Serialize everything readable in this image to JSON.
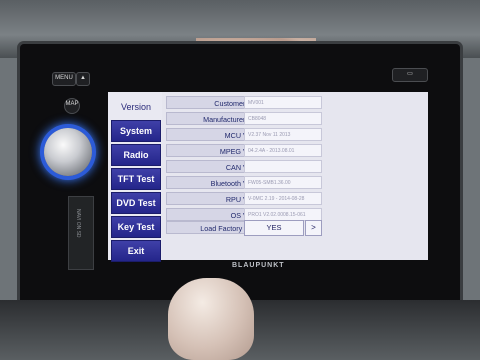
{
  "device": {
    "brand": "BLAUPUNKT",
    "hw_buttons": [
      "MENU",
      "MAP"
    ],
    "slot_label": "NAVI ON SD"
  },
  "menu": {
    "items": [
      {
        "label": "Version",
        "active": true
      },
      {
        "label": "System"
      },
      {
        "label": "Radio"
      },
      {
        "label": "TFT Test"
      },
      {
        "label": "DVD Test"
      },
      {
        "label": "Key Test"
      },
      {
        "label": "Exit"
      }
    ]
  },
  "rows": [
    {
      "label": "Customer Model",
      "value": "MV001"
    },
    {
      "label": "Manufacturer Model",
      "value": "CB8048"
    },
    {
      "label": "MCU Version",
      "value": "V2.37 Nov 11 2013"
    },
    {
      "label": "MPEG Version",
      "value": "04.2.4A - 2013.08.01"
    },
    {
      "label": "CAN Version",
      "value": ""
    },
    {
      "label": "Bluetooth Version",
      "value": "FW05-SMB1.36.00"
    },
    {
      "label": "RPU Version",
      "value": "V-0MC 2.19 - 2014-08-28"
    },
    {
      "label": "OS Version",
      "value": "PRO1 V2.02.0008.15-061"
    }
  ],
  "factory": {
    "label": "Load Factory Default",
    "yes_label": "YES",
    "arrow_label": ">"
  },
  "colors": {
    "tab_bg": "#2a2b92",
    "knob_glow": "#3a7bff",
    "screen_bg": "#e6e6ef"
  }
}
